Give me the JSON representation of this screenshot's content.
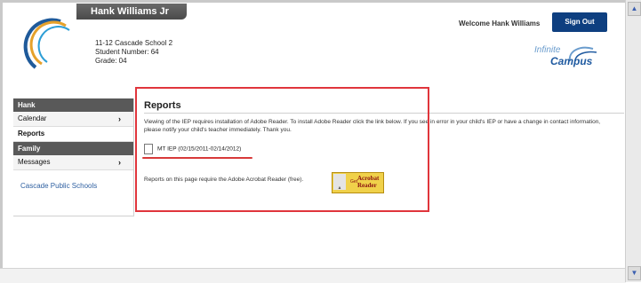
{
  "header": {
    "student_name": "Hank Williams Jr",
    "school": "11-12 Cascade School 2",
    "student_number": "Student Number: 64",
    "grade": "Grade: 04",
    "welcome": "Welcome Hank Williams",
    "sign_out": "Sign Out",
    "brand_line1": "Infinite",
    "brand_line2": "Campus"
  },
  "sidebar": {
    "student_section": "Hank",
    "items": [
      {
        "label": "Calendar",
        "chevron": "›"
      },
      {
        "label": "Reports"
      }
    ],
    "family_section": "Family",
    "family_items": [
      {
        "label": "Messages",
        "chevron": "›"
      }
    ],
    "district_link": "Cascade Public Schools"
  },
  "main": {
    "title": "Reports",
    "description": "Viewing of the IEP requires installation of Adobe Reader. To install Adobe Reader click the link below. If you see in error in your child's IEP or have a change in contact information, please notify your child's teacher immediately. Thank you.",
    "document_link": "MT IEP (02/15/2011-02/14/2012)",
    "reader_note": "Reports on this page require the Adobe Acrobat Reader (free).",
    "adobe_badge": {
      "get": "Get",
      "product": "Acrobat Reader",
      "brand": "Adobe",
      "icon": "A"
    }
  },
  "scrollbar": {
    "up": "▲",
    "down": "▼"
  },
  "colors": {
    "sign_out_bg": "#0e3f80",
    "sidebar_header": "#595959",
    "annotation_red": "#e0353c",
    "link_blue": "#2d5fa0"
  }
}
